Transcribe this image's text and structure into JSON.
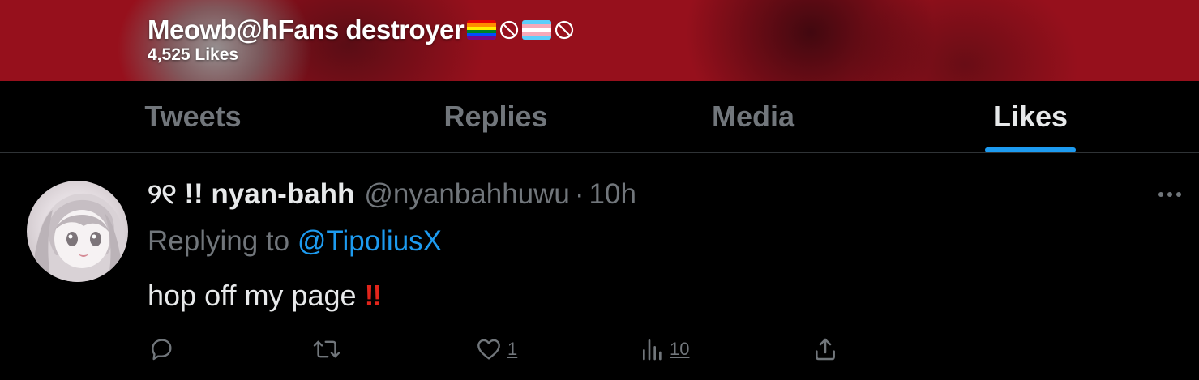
{
  "profile": {
    "name": "Meowb@hFans destroyer",
    "likes_label": "4,525 Likes"
  },
  "tabs": [
    {
      "label": "Tweets",
      "active": false
    },
    {
      "label": "Replies",
      "active": false
    },
    {
      "label": "Media",
      "active": false
    },
    {
      "label": "Likes",
      "active": true
    }
  ],
  "tweet": {
    "display_name": "୨୧ !! nyan-bahh",
    "handle": "@nyanbahhuwu",
    "separator": "·",
    "time": "10h",
    "replying_prefix": "Replying to",
    "replying_to": "@TipoliusX",
    "text": "hop off my page",
    "emphasis": "!!",
    "actions": {
      "likes": "1",
      "views": "10"
    }
  },
  "icons": {
    "banner": [
      "rainbow-flag-icon",
      "no-entry-icon",
      "trans-flag-icon",
      "no-entry-icon"
    ],
    "actions": [
      "reply-icon",
      "retweet-icon",
      "like-icon",
      "views-icon",
      "share-icon"
    ],
    "more": "more-icon"
  },
  "colors": {
    "banner": "#96101c",
    "background": "#000000",
    "accent": "#1d9bf0",
    "text_primary": "#e7e9ea",
    "text_secondary": "#71767b",
    "emphasis": "#e1251b"
  }
}
